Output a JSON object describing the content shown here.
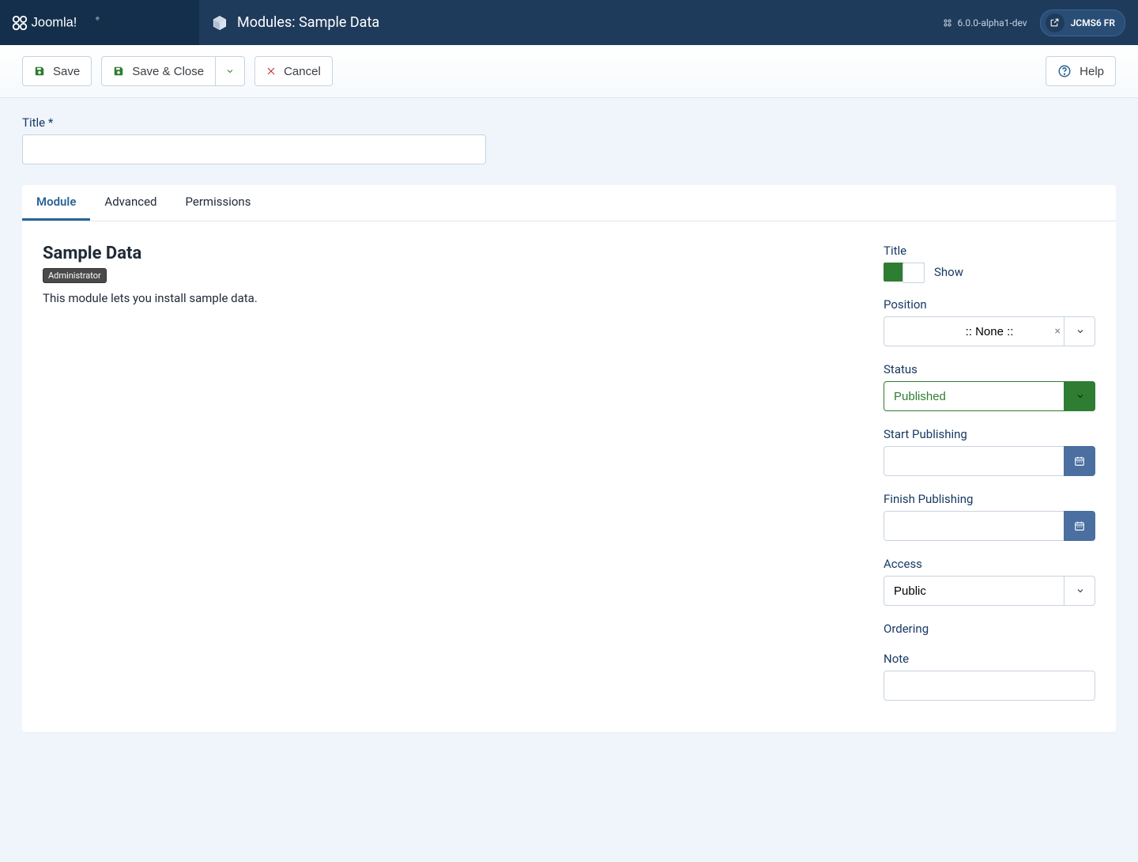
{
  "header": {
    "brand": "Joomla!",
    "page_title": "Modules: Sample Data",
    "version": "6.0.0-alpha1-dev",
    "site_name": "JCMS6 FR"
  },
  "toolbar": {
    "save": "Save",
    "save_close": "Save & Close",
    "cancel": "Cancel",
    "help": "Help"
  },
  "form": {
    "title_label": "Title",
    "title_value": ""
  },
  "tabs": [
    {
      "label": "Module",
      "active": true
    },
    {
      "label": "Advanced",
      "active": false
    },
    {
      "label": "Permissions",
      "active": false
    }
  ],
  "module": {
    "name": "Sample Data",
    "badge": "Administrator",
    "description": "This module lets you install sample data."
  },
  "sidebar": {
    "title_label": "Title",
    "title_toggle_state": "Show",
    "position_label": "Position",
    "position_value": ":: None ::",
    "status_label": "Status",
    "status_value": "Published",
    "start_pub_label": "Start Publishing",
    "start_pub_value": "",
    "finish_pub_label": "Finish Publishing",
    "finish_pub_value": "",
    "access_label": "Access",
    "access_value": "Public",
    "ordering_label": "Ordering",
    "note_label": "Note",
    "note_value": ""
  }
}
